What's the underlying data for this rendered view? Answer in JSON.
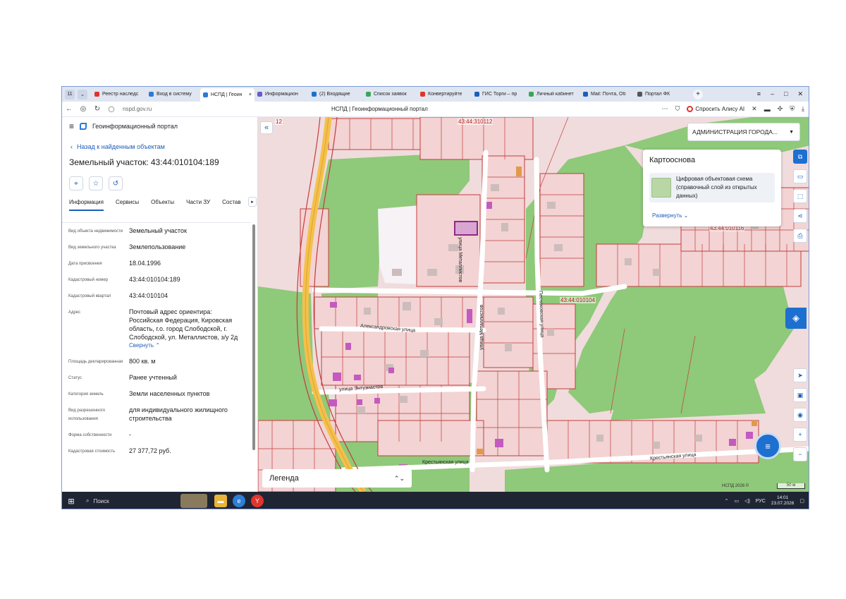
{
  "browser": {
    "tabs": [
      {
        "label": "Реестр наследс",
        "color": "#e0342c"
      },
      {
        "label": "Вход в систему",
        "color": "#2a7bd8"
      },
      {
        "label": "НСПД | Геоин",
        "color": "#2a7bd8",
        "active": true
      },
      {
        "label": "Информацион",
        "color": "#6a5acd"
      },
      {
        "label": "(2) Входящие",
        "color": "#1d6fd0"
      },
      {
        "label": "Список заявок",
        "color": "#3aa757"
      },
      {
        "label": "Конвертируйте",
        "color": "#e0342c"
      },
      {
        "label": "ГИС Торги – пр",
        "color": "#1d5fb8"
      },
      {
        "label": "Личный кабинет",
        "color": "#3aa757"
      },
      {
        "label": "Mail: Почта, Об",
        "color": "#1d5fb8"
      },
      {
        "label": "Портал ФК",
        "color": "#555555"
      }
    ],
    "tab_close": "×",
    "new_tab": "+",
    "window_controls": [
      "≡",
      "–",
      "□",
      "✕"
    ],
    "url": "nspd.gov.ru",
    "page_title": "НСПД | Геоинформационный портал",
    "alice_label": "Спросить Алису AI"
  },
  "panel": {
    "portal_name": "Геоинформационный портал",
    "back_label": "Назад к найденным объектам",
    "title": "Земельный участок: 43:44:010104:189",
    "tabs": [
      "Информация",
      "Сервисы",
      "Объекты",
      "Части ЗУ",
      "Состав"
    ],
    "props": [
      {
        "label": "Вид объекта недвижимости",
        "value": "Земельный участок"
      },
      {
        "label": "Вид земельного участка",
        "value": "Землепользование"
      },
      {
        "label": "Дата присвоения",
        "value": "18.04.1996"
      },
      {
        "label": "Кадастровый номер",
        "value": "43:44:010104:189"
      },
      {
        "label": "Кадастровый квартал",
        "value": "43:44:010104"
      },
      {
        "label": "Адрес",
        "value": "Почтовый адрес ориентира: Российская Федерация, Кировская область, г.о. город Слободской, г. Слободской, ул. Металлистов, з/у 2д",
        "link": "Свернуть"
      },
      {
        "label": "Площадь декларированная",
        "value": "800 кв. м"
      },
      {
        "label": "Статус",
        "value": "Ранее учтенный"
      },
      {
        "label": "Категория земель",
        "value": "Земли населенных пунктов"
      },
      {
        "label": "Вид разрешенного использования",
        "value": "для индивидуального жилищного строительства"
      },
      {
        "label": "Форма собственности",
        "value": "-"
      },
      {
        "label": "Кадастровая стоимость",
        "value": "27 377,72 руб."
      }
    ]
  },
  "map": {
    "admin_select": "АДМИНИСТРАЦИЯ ГОРОДА...",
    "basemap_title": "Картооснова",
    "basemap_item": "Цифровая объектовая схема (справочный слой из открытых данных)",
    "basemap_expand": "Развернуть",
    "legend": "Легенда",
    "copyright": "НСПД 2026 ©",
    "scale": "50 м",
    "cadastral_labels": [
      "43:44:310112",
      "43:44:010104",
      "43:44:010116",
      "12"
    ],
    "streets": [
      "Александровская улица",
      "улица Энтузиастов",
      "Крестьянская улица",
      "Крестьянская улица",
      "улица Металлистов",
      "улица Металлистов",
      "Песчаковская улица"
    ]
  },
  "taskbar": {
    "search": "Поиск",
    "lang": "РУС",
    "time": "14:01",
    "date": "23.07.2026"
  },
  "colors": {
    "accent": "#1d6fd0",
    "parcel_fill": "#f3d3d3",
    "parcel_border": "#c43c3c",
    "green": "#8fc97a",
    "selected": "#b13fa0"
  }
}
